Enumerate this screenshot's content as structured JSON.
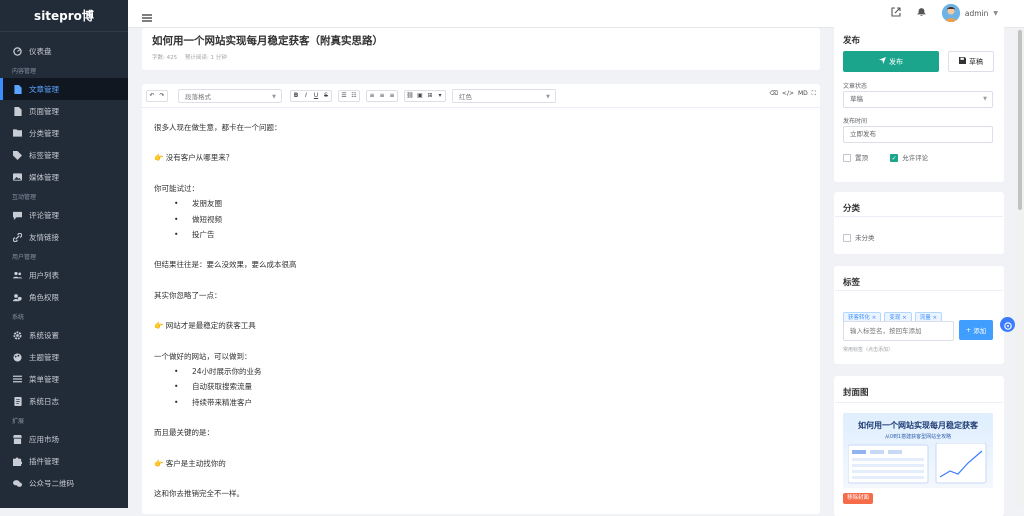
{
  "sidebar": {
    "logo": "sitepro博",
    "dashboard": "仪表盘",
    "sections": {
      "content": "内容管理",
      "interact": "互动管理",
      "users": "用户管理",
      "system": "系统",
      "extend": "扩展"
    },
    "items": {
      "articles": "文章管理",
      "pages": "页面管理",
      "categories": "分类管理",
      "tags": "标签管理",
      "media": "媒体管理",
      "comments": "评论管理",
      "links": "友情链接",
      "user_list": "用户列表",
      "roles": "角色权限",
      "settings": "系统设置",
      "themes": "主题管理",
      "menus": "菜单管理",
      "logs": "系统日志",
      "market": "应用市场",
      "plugins": "插件管理",
      "wechat": "公众号二维码"
    }
  },
  "topbar": {
    "user": "admin"
  },
  "article": {
    "title": "如何用一个网站实现每月稳定获客（附真实思路）",
    "word_count": "字数: 425",
    "read_time": "预计阅读: 1 分钟"
  },
  "editor": {
    "paragraph_format": "段落格式",
    "color": "红色",
    "md_label": "MD",
    "lines": {
      "l1": "很多人现在做生意，都卡在一个问题：",
      "l2": "👉 没有客户从哪里来？",
      "l3": "你可能试过：",
      "l3a": "发朋友圈",
      "l3b": "做短视频",
      "l3c": "投广告",
      "l4": "但结果往往是：要么没效果，要么成本很高",
      "l5": "其实你忽略了一点：",
      "l6": "👉 网站才是最稳定的获客工具",
      "l7": "一个做好的网站，可以做到：",
      "l7a": "24小时展示你的业务",
      "l7b": "自动获取搜索流量",
      "l7c": "持续带来精准客户",
      "l8": "而且最关键的是：",
      "l9": "👉 客户是主动找你的",
      "l10": "这和你去推销完全不一样。"
    }
  },
  "publish": {
    "heading": "发布",
    "publish_btn": "发布",
    "draft_btn": "草稿",
    "status_label": "文章状态",
    "status_value": "草稿",
    "time_label": "发布时间",
    "time_value": "立即发布",
    "pin_label": "置顶",
    "comment_label": "允许评论"
  },
  "category": {
    "heading": "分类",
    "item": "未分类"
  },
  "tags": {
    "heading": "标签",
    "list": [
      "获客转化",
      "变现",
      "流量"
    ],
    "placeholder": "输入标签名，按回车添加",
    "add_btn": "添加",
    "common": "常用标签（点击添加）"
  },
  "cover": {
    "heading": "封面图",
    "img_title": "如何用一个网站实现每月稳定获客",
    "img_subtitle": "从0到1搭建获客型网站全攻略",
    "remove_btn": "移除封面"
  }
}
